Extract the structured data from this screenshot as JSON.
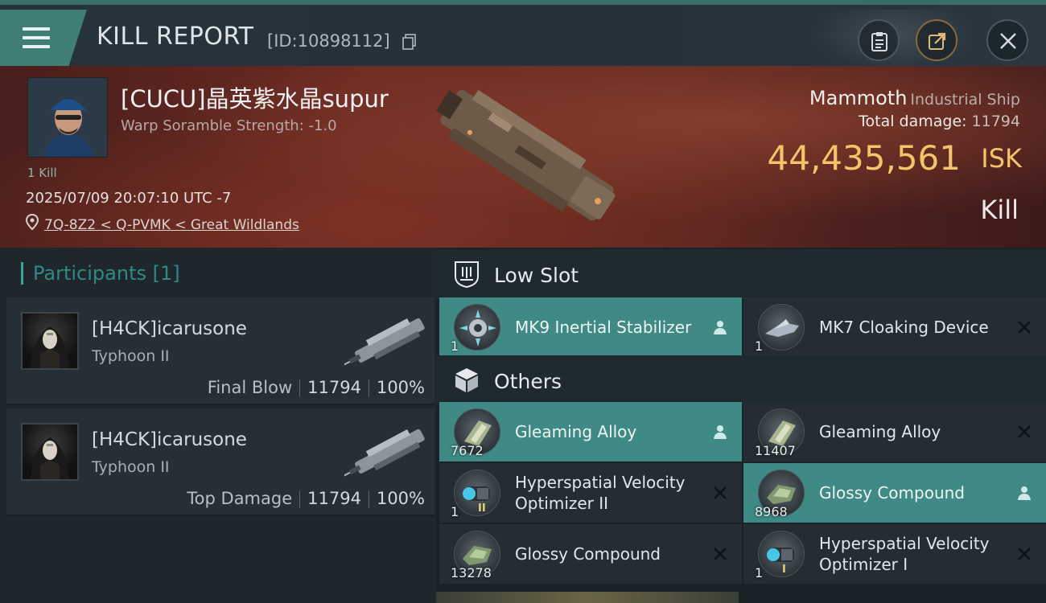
{
  "header": {
    "title": "KILL REPORT",
    "report_id": "[ID:10898112]"
  },
  "victim": {
    "name": "[CUCU]晶英紫水晶supur",
    "warp_scramble": "Warp Soramble Strength: -1.0",
    "kills": "1 Kill",
    "datetime": "2025/07/09 20:07:10 UTC -7",
    "location": "7Q-8Z2 < Q-PVMK < Great Wildlands",
    "ship_name": "Mammoth",
    "ship_class": "Industrial Ship",
    "total_damage_label": "Total damage:",
    "total_damage": "11794",
    "isk_value": "44,435,561",
    "isk_unit": "ISK",
    "result": "Kill"
  },
  "participants": {
    "heading": "Participants",
    "count": "[1]",
    "rows": [
      {
        "name": "[H4CK]icarusone",
        "ship": "Typhoon II",
        "role": "Final Blow",
        "damage": "11794",
        "percent": "100%"
      },
      {
        "name": "[H4CK]icarusone",
        "ship": "Typhoon II",
        "role": "Top Damage",
        "damage": "11794",
        "percent": "100%"
      }
    ]
  },
  "sections": {
    "low_slot": "Low Slot",
    "others": "Others"
  },
  "items": {
    "low_slot": [
      {
        "name": "MK9 Inertial Stabilizer",
        "qty": "1",
        "status": "dropped"
      },
      {
        "name": "MK7 Cloaking Device",
        "qty": "1",
        "status": "destroyed"
      }
    ],
    "others": [
      {
        "name": "Gleaming Alloy",
        "qty": "7672",
        "status": "dropped"
      },
      {
        "name": "Gleaming Alloy",
        "qty": "11407",
        "status": "destroyed"
      },
      {
        "name": "Hyperspatial Velocity Optimizer II",
        "qty": "1",
        "status": "destroyed",
        "tier": "II"
      },
      {
        "name": "Glossy Compound",
        "qty": "8968",
        "status": "dropped"
      },
      {
        "name": "Glossy Compound",
        "qty": "13278",
        "status": "destroyed"
      },
      {
        "name": "Hyperspatial Velocity Optimizer I",
        "qty": "1",
        "status": "destroyed",
        "tier": "I"
      }
    ]
  },
  "colors": {
    "accent_teal": "#3f8a84",
    "isk_gold": "#f3c46a",
    "banner_red": "#6a2a22",
    "panel_dark": "#242d33"
  }
}
